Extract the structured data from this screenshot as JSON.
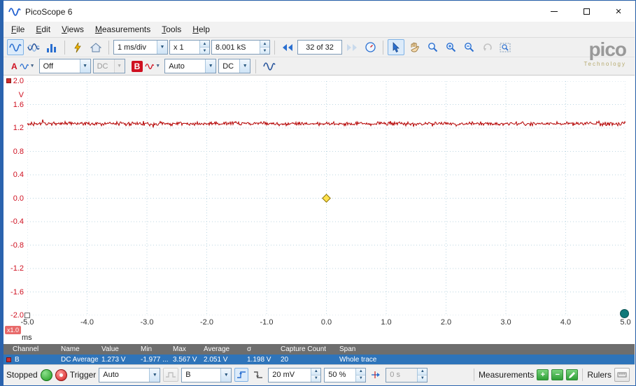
{
  "window": {
    "title": "PicoScope 6"
  },
  "menu": {
    "items": [
      "File",
      "Edit",
      "Views",
      "Measurements",
      "Tools",
      "Help"
    ]
  },
  "toolbar": {
    "timebase_value": "1 ms/div",
    "zoom_factor_value": "x 1",
    "samples_value": "8.001 kS",
    "buffer_position": "32 of 32"
  },
  "channels": {
    "a_label": "A",
    "a_range_value": "Off",
    "a_coupling_value": "DC",
    "b_label": "B",
    "b_range_value": "Auto",
    "b_coupling_value": "DC"
  },
  "brand": {
    "name": "pico",
    "tagline": "Technology"
  },
  "scope": {
    "y_unit": "V",
    "x_unit": "ms",
    "zoom_badge": "x1.0",
    "y_labels": [
      "2.0",
      "1.6",
      "1.2",
      "0.8",
      "0.4",
      "0.0",
      "-0.4",
      "-0.8",
      "-1.2",
      "-1.6",
      "-2.0"
    ],
    "x_labels": [
      "-5.0",
      "-4.0",
      "-3.0",
      "-2.0",
      "-1.0",
      "0.0",
      "1.0",
      "2.0",
      "3.0",
      "4.0",
      "5.0"
    ],
    "trace": {
      "channel": "B",
      "average_v": 1.273,
      "y_min": -2,
      "y_max": 2,
      "color": "#b40000"
    }
  },
  "measurements_table": {
    "headers": [
      "Channel",
      "Name",
      "Value",
      "Min",
      "Max",
      "Average",
      "σ",
      "Capture Count",
      "Span"
    ],
    "rows": [
      {
        "channel": "B",
        "name": "DC Average",
        "value": "1.273 V",
        "min": "-1.977 ...",
        "max": "3.567 V",
        "average": "2.051 V",
        "sigma": "1.198 V",
        "capture_count": "20",
        "span": "Whole trace"
      }
    ]
  },
  "statusbar": {
    "status": "Stopped",
    "trigger_label": "Trigger",
    "trigger_mode_value": "Auto",
    "trigger_source_value": "B",
    "trigger_level_value": "20 mV",
    "pre_trigger_value": "50 %",
    "trigger_delay_value": "0 s",
    "measurements_label": "Measurements",
    "rulers_label": "Rulers"
  },
  "colors": {
    "channel_b_red": "#cf1020",
    "selected_row_blue": "#2e74ba",
    "window_accent_blue": "#2a63ae",
    "trigger_marker_yellow": "#ffe14d"
  },
  "icons": {
    "app-icon": "sine-wave",
    "scope-mode-icon": "sine-wave",
    "persistence-mode-icon": "layered-waves",
    "spectrum-mode-icon": "bar-chart",
    "auto-setup-icon": "lightning",
    "home-icon": "house",
    "previous-buffer-icon": "double-left-arrows",
    "next-buffer-icon": "double-right-arrows",
    "buffer-overview-icon": "circled-dial",
    "pointer-icon": "cursor-arrow",
    "pan-icon": "hand",
    "marquee-zoom-icon": "magnifier",
    "zoom-in-icon": "magnifier-plus",
    "zoom-out-icon": "magnifier-minus",
    "undo-zoom-icon": "curved-arrow",
    "zoom-overview-icon": "magnifier-frame",
    "trigger-marker-icon": "yellow-diamond",
    "go-icon": "green-circle",
    "stop-icon": "red-circle",
    "rising-edge-icon": "rising-edge",
    "falling-edge-icon": "falling-edge",
    "add-icon": "plus",
    "remove-icon": "minus",
    "edit-icon": "pencil",
    "rulers-icon": "ruler"
  }
}
